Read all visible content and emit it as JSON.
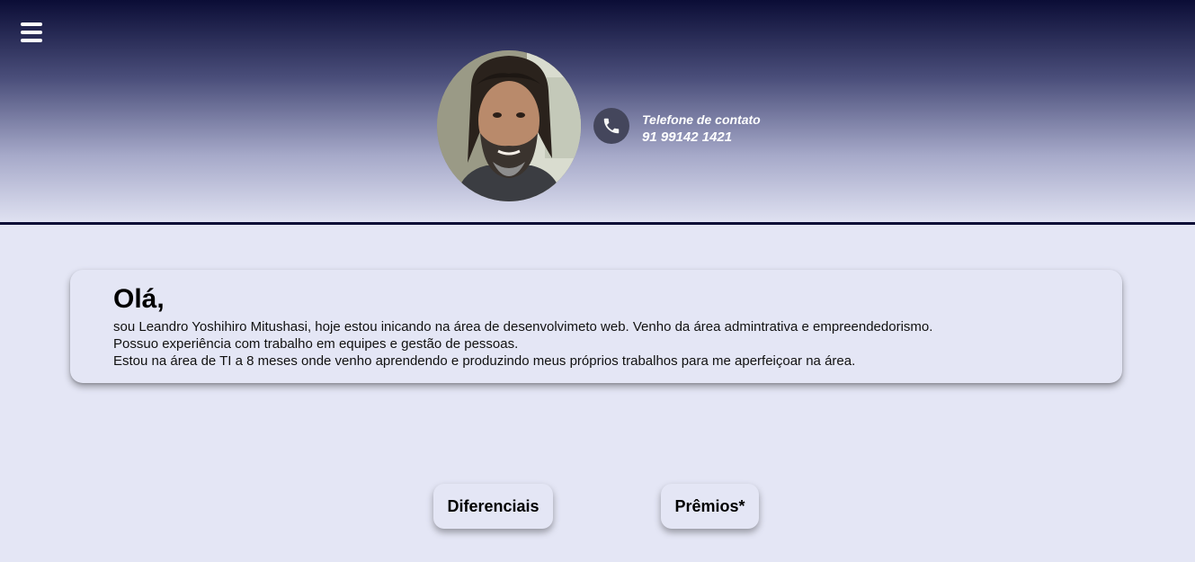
{
  "header": {
    "menu_icon": "hamburger-menu-icon",
    "avatar_alt": "Leandro Yoshihiro Mitushasi",
    "contact": {
      "icon": "phone-icon",
      "label": "Telefone de contato",
      "number": "91 99142 1421"
    }
  },
  "intro": {
    "title": "Olá,",
    "lines": [
      "sou Leandro Yoshihiro Mitushasi, hoje estou inicando na área de desenvolvimeto web. Venho da área admintrativa e empreendedorismo.",
      "Possuo experiência com trabalho em equipes e gestão de pessoas.",
      "Estou na área de TI a 8 meses onde venho aprendendo e produzindo meus próprios trabalhos para me aperfeiçoar na área."
    ]
  },
  "tabs": [
    {
      "label": "Diferenciais"
    },
    {
      "label": "Prêmios*"
    }
  ],
  "colors": {
    "header_dark": "#0b0d36",
    "background": "#e4e6f5",
    "phone_circle": "#44465c"
  }
}
